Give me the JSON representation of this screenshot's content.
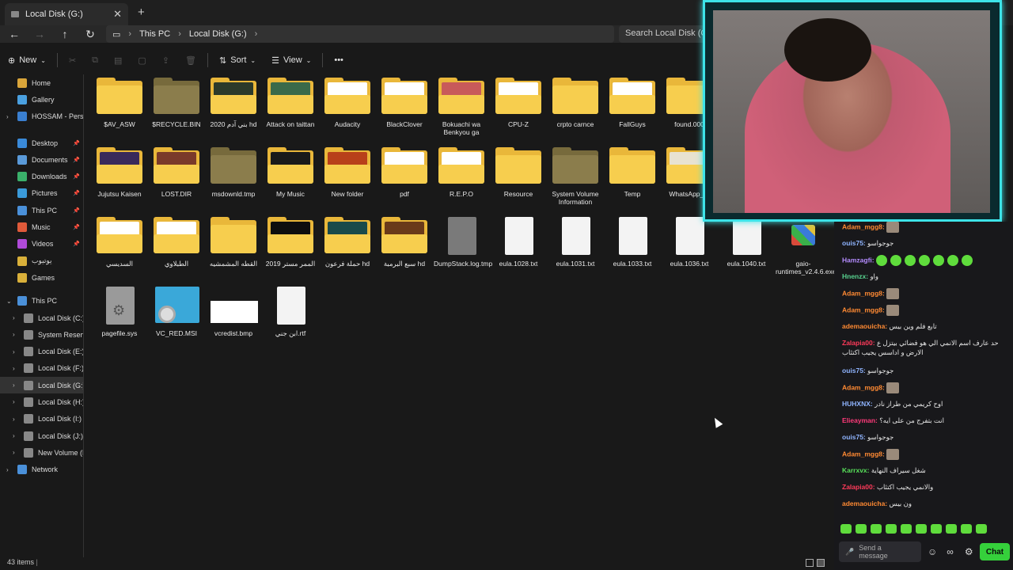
{
  "tab": {
    "title": "Local Disk (G:)",
    "close": "✕",
    "new": "+"
  },
  "address": {
    "root": "This PC",
    "current": "Local Disk (G:)",
    "sep": "›"
  },
  "search": {
    "placeholder": "Search Local Disk (G:)"
  },
  "toolbar": {
    "new": "New",
    "sort": "Sort",
    "view": "View",
    "more": "•••"
  },
  "sidebar": {
    "quick": [
      {
        "label": "Home",
        "icon": "home-icon"
      },
      {
        "label": "Gallery",
        "icon": "gallery-icon"
      },
      {
        "label": "HOSSAM - Persona",
        "icon": "cloud-icon"
      }
    ],
    "pinned": [
      {
        "label": "Desktop"
      },
      {
        "label": "Documents"
      },
      {
        "label": "Downloads"
      },
      {
        "label": "Pictures"
      },
      {
        "label": "This PC"
      },
      {
        "label": "Music"
      },
      {
        "label": "Videos"
      },
      {
        "label": "يوتيوب"
      },
      {
        "label": "Games"
      }
    ],
    "thispc": "This PC",
    "drives": [
      {
        "label": "Local Disk (C:)"
      },
      {
        "label": "System Reserved (D:)"
      },
      {
        "label": "Local Disk (E:)"
      },
      {
        "label": "Local Disk (F:)"
      },
      {
        "label": "Local Disk (G:)"
      },
      {
        "label": "Local Disk (H:)"
      },
      {
        "label": "Local Disk (I:)"
      },
      {
        "label": "Local Disk (J:)"
      },
      {
        "label": "New Volume (L:)"
      }
    ],
    "network": "Network"
  },
  "files": [
    {
      "name": "$AV_ASW",
      "kind": "folder"
    },
    {
      "name": "$RECYCLE.BIN",
      "kind": "folder-gray"
    },
    {
      "name": "بني آدم 2020 hd",
      "kind": "folder",
      "preview": "#2c3a2a"
    },
    {
      "name": "Attack on taittan",
      "kind": "folder",
      "preview": "#3a6a4a"
    },
    {
      "name": "Audacity",
      "kind": "folder",
      "preview": "#ffffff"
    },
    {
      "name": "BlackClover",
      "kind": "folder",
      "preview": "#ffffff"
    },
    {
      "name": "Bokuachi wa Benkyou ga",
      "kind": "folder",
      "preview": "#c85a5a"
    },
    {
      "name": "CPU-Z",
      "kind": "folder",
      "preview": "#ffffff"
    },
    {
      "name": "crpto carnce",
      "kind": "folder"
    },
    {
      "name": "FallGuys",
      "kind": "folder",
      "preview": "#ffffff"
    },
    {
      "name": "found.000",
      "kind": "folder"
    },
    {
      "name": "Jujutsu Kaisen",
      "kind": "folder",
      "preview": "#3a2a5a"
    },
    {
      "name": "LOST.DIR",
      "kind": "folder",
      "preview": "#7a3a2a"
    },
    {
      "name": "msdownld.tmp",
      "kind": "folder-gray"
    },
    {
      "name": "My Music",
      "kind": "folder",
      "preview": "#1a1a1a"
    },
    {
      "name": "New folder",
      "kind": "folder",
      "preview": "#b8401a"
    },
    {
      "name": "pdf",
      "kind": "folder",
      "preview": "#ffffff"
    },
    {
      "name": "R.E.P.O",
      "kind": "folder",
      "preview": "#ffffff"
    },
    {
      "name": "Resource",
      "kind": "folder"
    },
    {
      "name": "System Volume Information",
      "kind": "folder-gray"
    },
    {
      "name": "Temp",
      "kind": "folder"
    },
    {
      "name": "WhatsApp_Vi",
      "kind": "folder",
      "preview": "#e8e2d0"
    },
    {
      "name": "السديسي",
      "kind": "folder",
      "preview": "#ffffff"
    },
    {
      "name": "الطبلاوي",
      "kind": "folder",
      "preview": "#ffffff"
    },
    {
      "name": "القطه المشمشيه",
      "kind": "folder"
    },
    {
      "name": "الممر مستر 2019",
      "kind": "folder",
      "preview": "#0e0e0e"
    },
    {
      "name": "حملة فرعون hd",
      "kind": "folder",
      "preview": "#1a4a4a"
    },
    {
      "name": "سبع البرمبة hd",
      "kind": "folder",
      "preview": "#6a3a1a"
    },
    {
      "name": "DumpStack.log.tmp",
      "kind": "file-gray"
    },
    {
      "name": "eula.1028.txt",
      "kind": "file"
    },
    {
      "name": "eula.1031.txt",
      "kind": "file"
    },
    {
      "name": "eula.1033.txt",
      "kind": "file"
    },
    {
      "name": "eula.1036.txt",
      "kind": "file"
    },
    {
      "name": "eula.1040.txt",
      "kind": "file"
    },
    {
      "name": "gaio-runtimes_v2.4.6.exe",
      "kind": "exe"
    },
    {
      "name": "pagefile.sys",
      "kind": "sys"
    },
    {
      "name": "VC_RED.MSI",
      "kind": "msi"
    },
    {
      "name": "vcredist.bmp",
      "kind": "bmp"
    },
    {
      "name": "ابن جني.rtf",
      "kind": "file"
    }
  ],
  "status": {
    "count": "43 items"
  },
  "chat": {
    "messages": [
      {
        "user": "Adam_mgg8:",
        "color": "#ff8a33",
        "text": "",
        "emote": "cat"
      },
      {
        "user": "ouis75:",
        "color": "#8fb4ff",
        "text": "جوجواسو",
        "emote": ""
      },
      {
        "user": "Hamzagfi:",
        "color": "#b48cff",
        "text": "",
        "emote": "frogs"
      },
      {
        "user": "Hnenzx:",
        "color": "#57d28f",
        "text": "واو",
        "emote": ""
      },
      {
        "user": "Adam_mgg8:",
        "color": "#ff8a33",
        "text": "",
        "emote": "cat"
      },
      {
        "user": "Adam_mgg8:",
        "color": "#ff8a33",
        "text": "",
        "emote": "cat"
      },
      {
        "user": "ademaouicha:",
        "color": "#ff8a33",
        "text": "تابع فلم وين بيس",
        "emote": ""
      },
      {
        "user": "Zalapia00:",
        "color": "#ff3a5a",
        "text": "حد عارف اسم الانمي الي هو فضائي بيتزل ع الارض و اداسس يجيب اكتئاب",
        "emote": ""
      },
      {
        "user": "ouis75:",
        "color": "#8fb4ff",
        "text": "جوجواسو",
        "emote": ""
      },
      {
        "user": "Adam_mgg8:",
        "color": "#ff8a33",
        "text": "",
        "emote": "cat"
      },
      {
        "user": "HUHXNX:",
        "color": "#8fb4ff",
        "text": "اوح كريمي من طراز نادر",
        "emote": ""
      },
      {
        "user": "Elieayman:",
        "color": "#ff3a7a",
        "text": "انت بتفرج من على ايه؟",
        "emote": ""
      },
      {
        "user": "ouis75:",
        "color": "#8fb4ff",
        "text": "جوجواسو",
        "emote": ""
      },
      {
        "user": "Adam_mgg8:",
        "color": "#ff8a33",
        "text": "",
        "emote": "cat"
      },
      {
        "user": "Karrxvx:",
        "color": "#57e05a",
        "text": "شغل سيراف النهاية",
        "emote": ""
      },
      {
        "user": "Zalapia00:",
        "color": "#ff3a5a",
        "text": "والانمي يجيب اكتئاب",
        "emote": ""
      },
      {
        "user": "ademaouicha:",
        "color": "#ff8a33",
        "text": "ون بيس",
        "emote": ""
      }
    ],
    "send_placeholder": "Send a message",
    "chat_button": "Chat"
  }
}
